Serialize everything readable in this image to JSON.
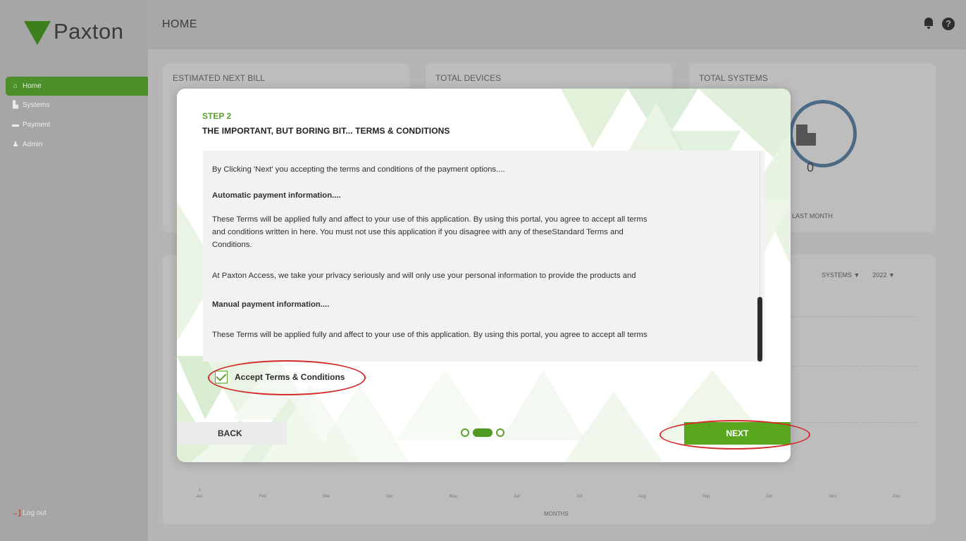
{
  "app": {
    "brand": "Paxton",
    "page_title": "HOME"
  },
  "sidebar": {
    "items": [
      {
        "label": "Home",
        "icon": "home-icon"
      },
      {
        "label": "Systems",
        "icon": "building-icon"
      },
      {
        "label": "Payment",
        "icon": "card-icon"
      },
      {
        "label": "Admin",
        "icon": "person-icon"
      }
    ],
    "logout_label": "Log out"
  },
  "dashboard": {
    "cards": [
      {
        "title": "ESTIMATED NEXT BILL"
      },
      {
        "title": "TOTAL DEVICES"
      },
      {
        "title": "TOTAL SYSTEMS"
      }
    ],
    "total_systems_value": "0",
    "last_month_label": "LAST MONTH",
    "filter_systems": "SYSTEMS ▼",
    "filter_year": "2022 ▼",
    "x_axis_title": "MONTHS",
    "y_axis_tick": "1",
    "months": [
      "Jan",
      "Feb",
      "Mar",
      "Apr",
      "May",
      "Jun",
      "Jul",
      "Aug",
      "Sep",
      "Oct",
      "Nov",
      "Dec"
    ]
  },
  "modal": {
    "step_label": "STEP 2",
    "heading": "THE IMPORTANT, BUT BORING BIT... TERMS & CONDITIONS",
    "terms": {
      "intro": "By Clicking 'Next' you accepting the terms and conditions of the payment options....",
      "auto_heading": "Automatic payment information....",
      "auto_line1": "These Terms will be applied fully and affect to your use of this application. By using this portal, you agree to accept all terms",
      "auto_line2": "and conditions written in here. You must not use this application if you disagree with any of theseStandard Terms and",
      "auto_line3": "Conditions.",
      "privacy": "At Paxton Access, we take your privacy seriously and will only use your personal information to provide the products and",
      "manual_heading": "Manual payment information....",
      "manual_line1": "These Terms will be applied fully and affect to your use of this application. By using this portal, you agree to accept all terms"
    },
    "accept_label": "Accept Terms & Conditions",
    "accept_checked": true,
    "back_label": "BACK",
    "next_label": "NEXT",
    "current_step": 2,
    "total_steps": 3
  },
  "colors": {
    "accent_green": "#59a71f",
    "annotation_red": "#d42b2b"
  }
}
